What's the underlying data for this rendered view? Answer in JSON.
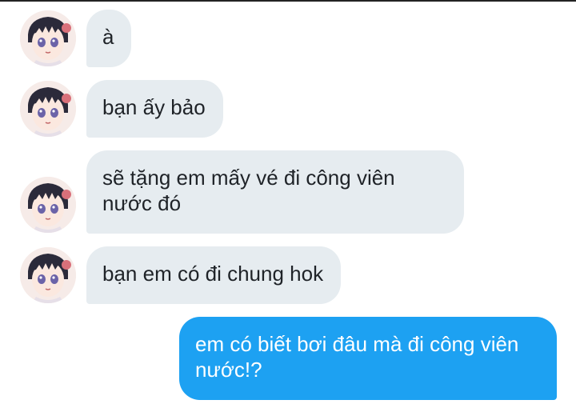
{
  "conversation": {
    "messages": [
      {
        "sender": "them",
        "text": "à"
      },
      {
        "sender": "them",
        "text": "bạn ấy bảo"
      },
      {
        "sender": "them",
        "text": "sẽ tặng em mấy vé đi công viên nước đó"
      },
      {
        "sender": "them",
        "text": "bạn em có đi chung hok"
      },
      {
        "sender": "me",
        "text": "em có biết bơi đâu mà đi công viên nước!?"
      }
    ]
  },
  "colors": {
    "incoming_bubble": "#e6ecf0",
    "outgoing_bubble": "#1da1f2",
    "incoming_text": "#1f2328",
    "outgoing_text": "#ffffff"
  },
  "icons": {
    "avatar": "anime-girl-avatar-icon"
  }
}
